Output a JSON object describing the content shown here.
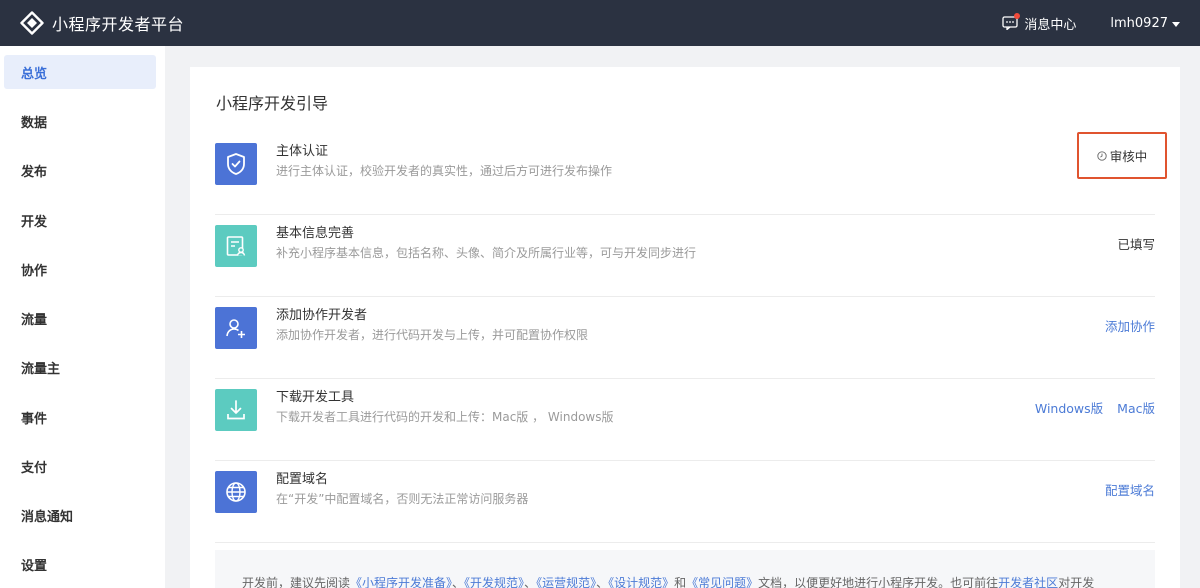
{
  "app": {
    "title": "小程序开发者平台"
  },
  "topbar": {
    "messages_label": "消息中心",
    "username": "lmh0927"
  },
  "sidebar": {
    "items": [
      {
        "label": "总览",
        "active": true
      },
      {
        "label": "数据"
      },
      {
        "label": "发布"
      },
      {
        "label": "开发"
      },
      {
        "label": "协作"
      },
      {
        "label": "流量"
      },
      {
        "label": "流量主"
      },
      {
        "label": "事件"
      },
      {
        "label": "支付"
      },
      {
        "label": "消息通知"
      },
      {
        "label": "设置"
      }
    ]
  },
  "guide": {
    "title": "小程序开发引导",
    "rows": [
      {
        "icon": "shield-check-icon",
        "icon_color": "#4c73d6",
        "title": "主体认证",
        "desc": "进行主体认证，校验开发者的真实性，通过后方可进行发布操作",
        "status": "审核中"
      },
      {
        "icon": "profile-card-icon",
        "icon_color": "#5ccbc0",
        "title": "基本信息完善",
        "desc": "补充小程序基本信息，包括名称、头像、简介及所属行业等，可与开发同步进行",
        "status": "已填写"
      },
      {
        "icon": "add-user-icon",
        "icon_color": "#4c73d6",
        "title": "添加协作开发者",
        "desc": "添加协作开发者，进行代码开发与上传，并可配置协作权限",
        "action": "添加协作"
      },
      {
        "icon": "download-icon",
        "icon_color": "#5ccbc0",
        "title": "下载开发工具",
        "desc": "下载开发者工具进行代码的开发和上传：Mac版 ， Windows版",
        "actions": [
          "Windows版",
          "Mac版"
        ]
      },
      {
        "icon": "globe-icon",
        "icon_color": "#4c73d6",
        "title": "配置域名",
        "desc": "在“开发”中配置域名，否则无法正常访问服务器",
        "action": "配置域名"
      }
    ]
  },
  "notice": {
    "t1": "开发前，建议先阅读",
    "l1": "《小程序开发准备》",
    "s1": "、",
    "l2": "《开发规范》",
    "s2": "、",
    "l3": "《运营规范》",
    "s3": "、",
    "l4": "《设计规范》",
    "s4": "和",
    "l5": "《常见问题》",
    "t2": "文档，以便更好地进行小程序开发。也可前往",
    "l6": "开发者社区",
    "t3": "对开发"
  },
  "colors": {
    "topbar": "#2b3241",
    "accent": "#4c7bd6",
    "highlight_border": "#e0542f",
    "teal": "#5ccbc0"
  }
}
